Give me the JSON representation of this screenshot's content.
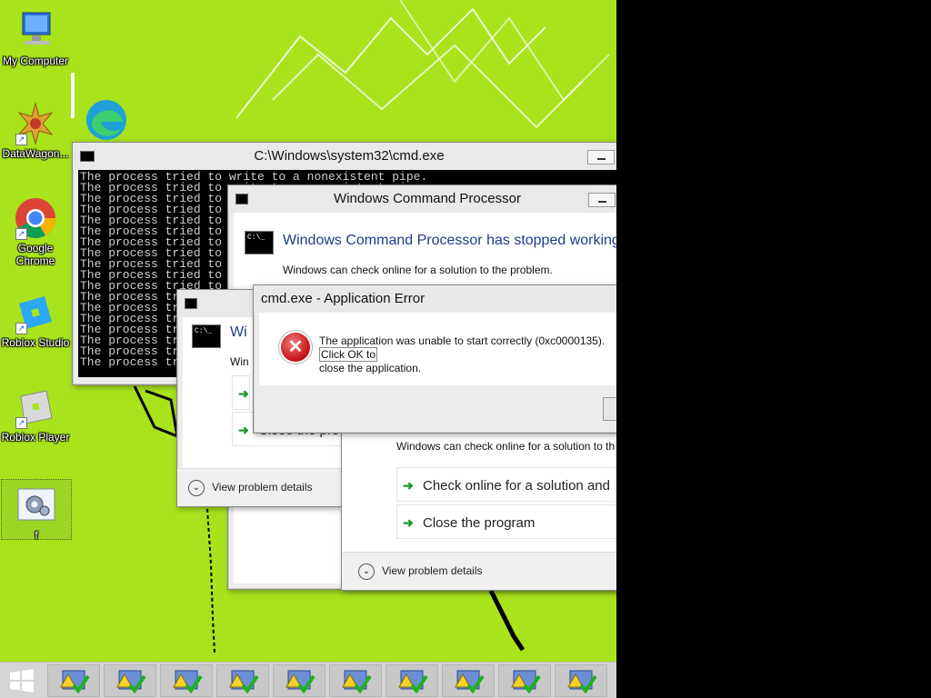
{
  "desktop": {
    "icons": [
      {
        "label": "My Computer",
        "icon": "computer-icon"
      },
      {
        "label": "DataWagon...",
        "icon": "datawagon-icon"
      },
      {
        "label": "",
        "icon": "edge-icon"
      },
      {
        "label": "Google Chrome",
        "icon": "chrome-icon"
      },
      {
        "label": "Roblox Studio",
        "icon": "roblox-studio-icon"
      },
      {
        "label": "Roblox Player",
        "icon": "roblox-player-icon"
      },
      {
        "label": "f",
        "icon": "settings-gear-icon"
      }
    ]
  },
  "console_window": {
    "title": "C:\\Windows\\system32\\cmd.exe",
    "first_line": "The process tried to write to a nonexistent pipe.",
    "repeat_line": "The process tried to write to a nonexistent pipe.",
    "line_count": 18
  },
  "wer_dialog_large": {
    "title": "Windows Command Processor",
    "heading": "Windows Command Processor has stopped working",
    "subtext": "Windows can check online for a solution to the problem.",
    "subtext_behind": "Windows can check online for a solution to th",
    "options": [
      "Check online for a solution and",
      "Close the program"
    ],
    "details": "View problem details"
  },
  "wer_dialog_small": {
    "heading_fragment": "Wi",
    "subtext_fragment": "Win",
    "option_fragment": "Close the pro",
    "details": "View problem details"
  },
  "error_dialog": {
    "title": "cmd.exe - Application Error",
    "message_main": "The application was unable to start correctly (0xc0000135).",
    "message_overflow": "Click OK to",
    "message_line2": "close the application."
  },
  "taskbar": {
    "button_count": 10,
    "button_icon": "warning-check-icon"
  },
  "colors": {
    "desktop_bg": "#a8e31c",
    "heading_blue": "#1e3c8c",
    "error_red": "#c8161a",
    "arrow_green": "#1a9a2a"
  }
}
